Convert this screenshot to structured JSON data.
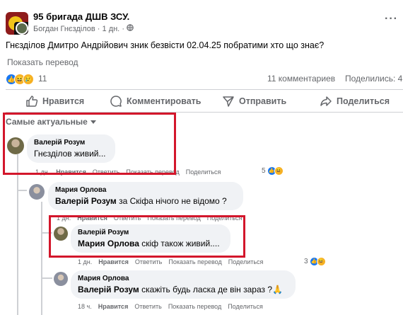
{
  "post": {
    "group_name": "95 бригада ДШВ ЗСУ.",
    "author": "Богдан Гнєзділов",
    "time": "1 дн.",
    "text": "Гнєзділов Дмитро Андрійович зник безвісти 02.04.25 побратими хто що знає?",
    "translate_label": "Показать перевод",
    "reaction_count": "11",
    "comments_count": "11 комментариев",
    "shares_count": "Поделились: 4"
  },
  "actions": {
    "like": "Нравится",
    "comment": "Комментировать",
    "send": "Отправить",
    "share": "Поделиться"
  },
  "sort": {
    "label": "Самые актуальные"
  },
  "comments": [
    {
      "author": "Валерій Розум",
      "text": "Гнєзділов живий...",
      "time": "1 дн.",
      "like": "Нравится",
      "reply": "Ответить",
      "translate": "Показать перевод",
      "share": "Поделиться",
      "reactions": "5"
    },
    {
      "author": "Мария Орлова",
      "mention": "Валерій Розум",
      "text": " за Скіфа нічого не відомо ?",
      "time": "1 дн.",
      "like": "Нравится",
      "reply": "Ответить",
      "translate": "Показать перевод",
      "share": "Поделиться"
    },
    {
      "author": "Валерій Розум",
      "mention": "Мария Орлова",
      "text": " скіф також живий....",
      "time": "1 дн.",
      "like": "Нравится",
      "reply": "Ответить",
      "translate": "Показать перевод",
      "share": "Поделиться",
      "reactions": "3"
    },
    {
      "author": "Мария Орлова",
      "mention": "Валерій Розум",
      "text": " скажіть будь ласка де він зараз ?🙏",
      "time": "18 ч.",
      "like": "Нравится",
      "reply": "Ответить",
      "translate": "Показать перевод",
      "share": "Поделиться"
    }
  ],
  "highlight_color": "#d3162b",
  "icons": [
    "more-icon",
    "globe-icon",
    "like-icon",
    "comment-icon",
    "send-icon",
    "share-icon",
    "caret-down-icon"
  ]
}
